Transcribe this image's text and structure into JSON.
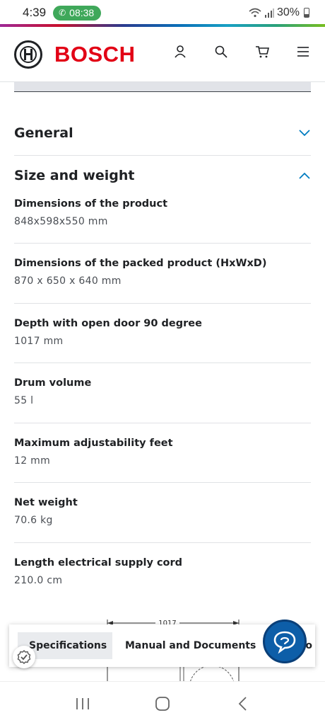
{
  "status_bar": {
    "time": "4:39",
    "call_duration": "08:38",
    "battery": "30%"
  },
  "header": {
    "brand": "BOSCH",
    "icons": [
      "account-icon",
      "search-icon",
      "cart-icon",
      "menu-icon"
    ]
  },
  "sections": {
    "general": {
      "title": "General",
      "expanded": false
    },
    "size_weight": {
      "title": "Size and weight",
      "expanded": true
    }
  },
  "specs": [
    {
      "label": "Dimensions of the product",
      "value": "848x598x550 mm"
    },
    {
      "label": "Dimensions of the packed product (HxWxD)",
      "value": "870 x 650 x 640 mm"
    },
    {
      "label": "Depth with open door 90 degree",
      "value": "1017 mm"
    },
    {
      "label": "Drum volume",
      "value": "55 l"
    },
    {
      "label": "Maximum adjustability feet",
      "value": "12 mm"
    },
    {
      "label": "Net weight",
      "value": "70.6 kg"
    },
    {
      "label": "Length electrical supply cord",
      "value": "210.0 cm"
    }
  ],
  "drawing": {
    "dimension_label": "1017"
  },
  "bottom_tabs": {
    "specifications": "Specifications",
    "manual": "Manual and Documents",
    "more": "o"
  },
  "colors": {
    "brand_red": "#e20015",
    "accent_teal": "#007bc0",
    "chat_blue": "#0d5ea8"
  }
}
